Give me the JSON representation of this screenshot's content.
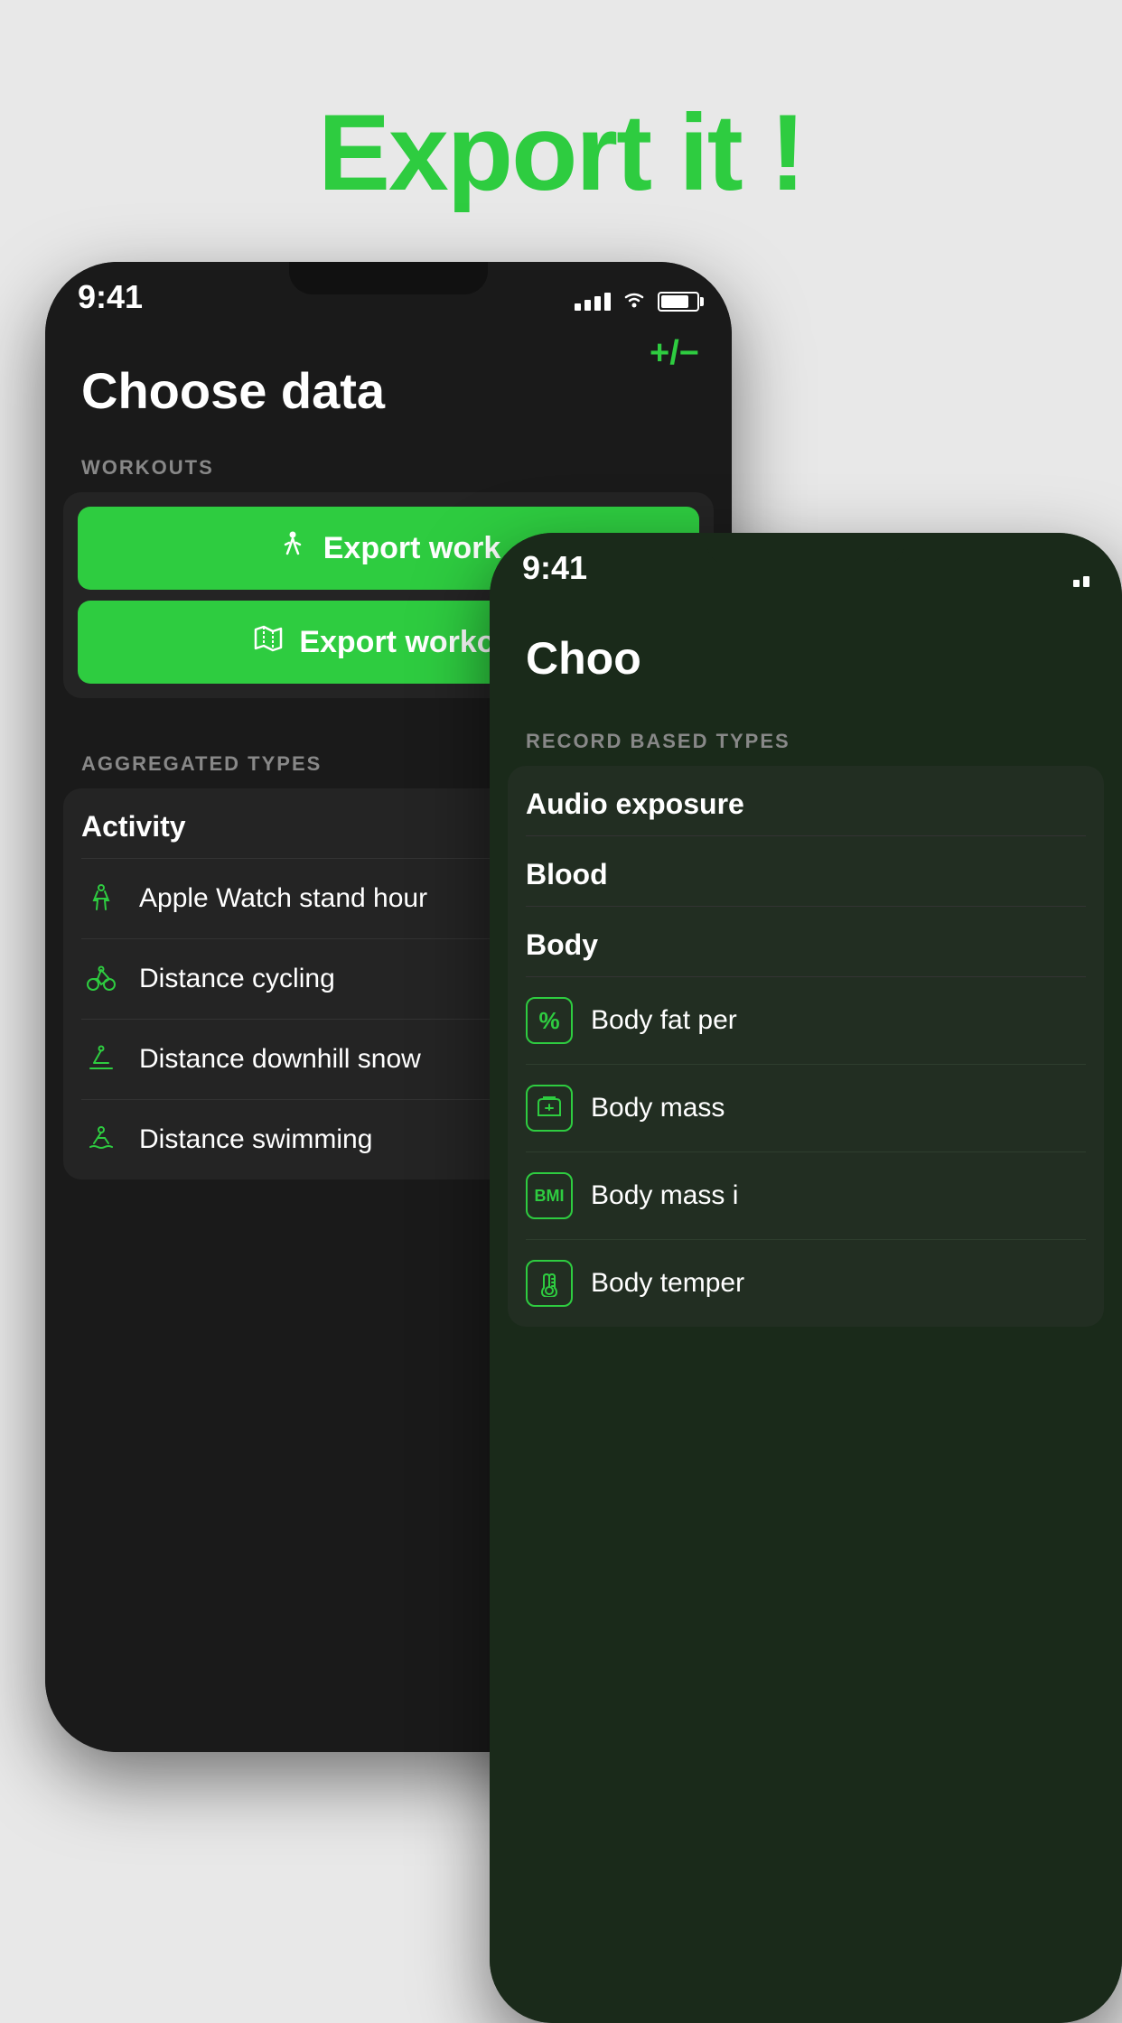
{
  "hero": {
    "title": "Export it !"
  },
  "colors": {
    "accent": "#2ecc40",
    "bg_dark": "#1a1a1a",
    "bg_card": "#242424",
    "text_primary": "#ffffff",
    "text_secondary": "#888888"
  },
  "phone_primary": {
    "status": {
      "time": "9:41"
    },
    "screen_title": "Choose data",
    "workouts_section_label": "WORKOUTS",
    "export_buttons": [
      {
        "icon": "walk",
        "label": "Export work"
      },
      {
        "icon": "map",
        "label": "Export workout"
      }
    ],
    "aggregated_section_label": "AGGREGATED TYPES",
    "activity_header": "Activity",
    "list_items": [
      {
        "icon": "stand",
        "text": "Apple Watch stand hour"
      },
      {
        "icon": "cycling",
        "text": "Distance cycling"
      },
      {
        "icon": "skiing",
        "text": "Distance downhill snow"
      },
      {
        "icon": "swimming",
        "text": "Distance swimming"
      }
    ],
    "plus_minus": "+/−"
  },
  "phone_secondary": {
    "status": {
      "time": "9:41"
    },
    "screen_title": "Choo",
    "record_section_label": "RECORD BASED TYPES",
    "group_headers": [
      "Audio exposure",
      "Blood",
      "Body"
    ],
    "list_items": [
      {
        "icon": "percent",
        "text": "Body fat per"
      },
      {
        "icon": "scale",
        "text": "Body mass"
      },
      {
        "icon": "bmi",
        "text": "Body mass i"
      },
      {
        "icon": "temp",
        "text": "Body temper"
      }
    ]
  }
}
